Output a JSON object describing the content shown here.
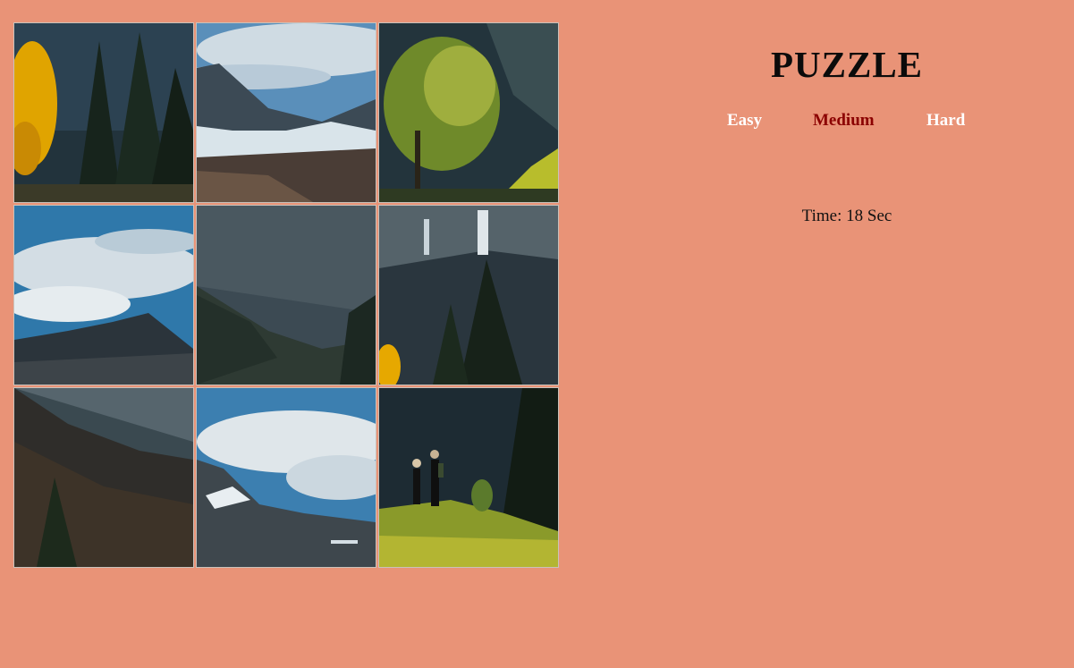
{
  "app": {
    "title": "PUZZLE",
    "background_color": "#e99377"
  },
  "levels": [
    {
      "label": "Easy",
      "active": false
    },
    {
      "label": "Medium",
      "active": true
    },
    {
      "label": "Hard",
      "active": false
    }
  ],
  "timer": {
    "text": "Time: 18 Sec"
  },
  "board": {
    "grid": "3x3",
    "tiles": [
      {
        "name": "tile-trees-yellow-leaves",
        "scene": "forest"
      },
      {
        "name": "tile-snowy-mountain-peak",
        "scene": "peak"
      },
      {
        "name": "tile-sunlit-tree",
        "scene": "sunlit"
      },
      {
        "name": "tile-sky-ridge",
        "scene": "sky"
      },
      {
        "name": "tile-rocky-cliff",
        "scene": "cliff"
      },
      {
        "name": "tile-waterfall-cliff",
        "scene": "waterfall"
      },
      {
        "name": "tile-mountain-slope",
        "scene": "slope"
      },
      {
        "name": "tile-sky-snowy-ridge",
        "scene": "skyridge"
      },
      {
        "name": "tile-hikers",
        "scene": "hikers"
      }
    ]
  },
  "colors": {
    "active_level": "#8b0000",
    "inactive_level": "#ffffff"
  }
}
